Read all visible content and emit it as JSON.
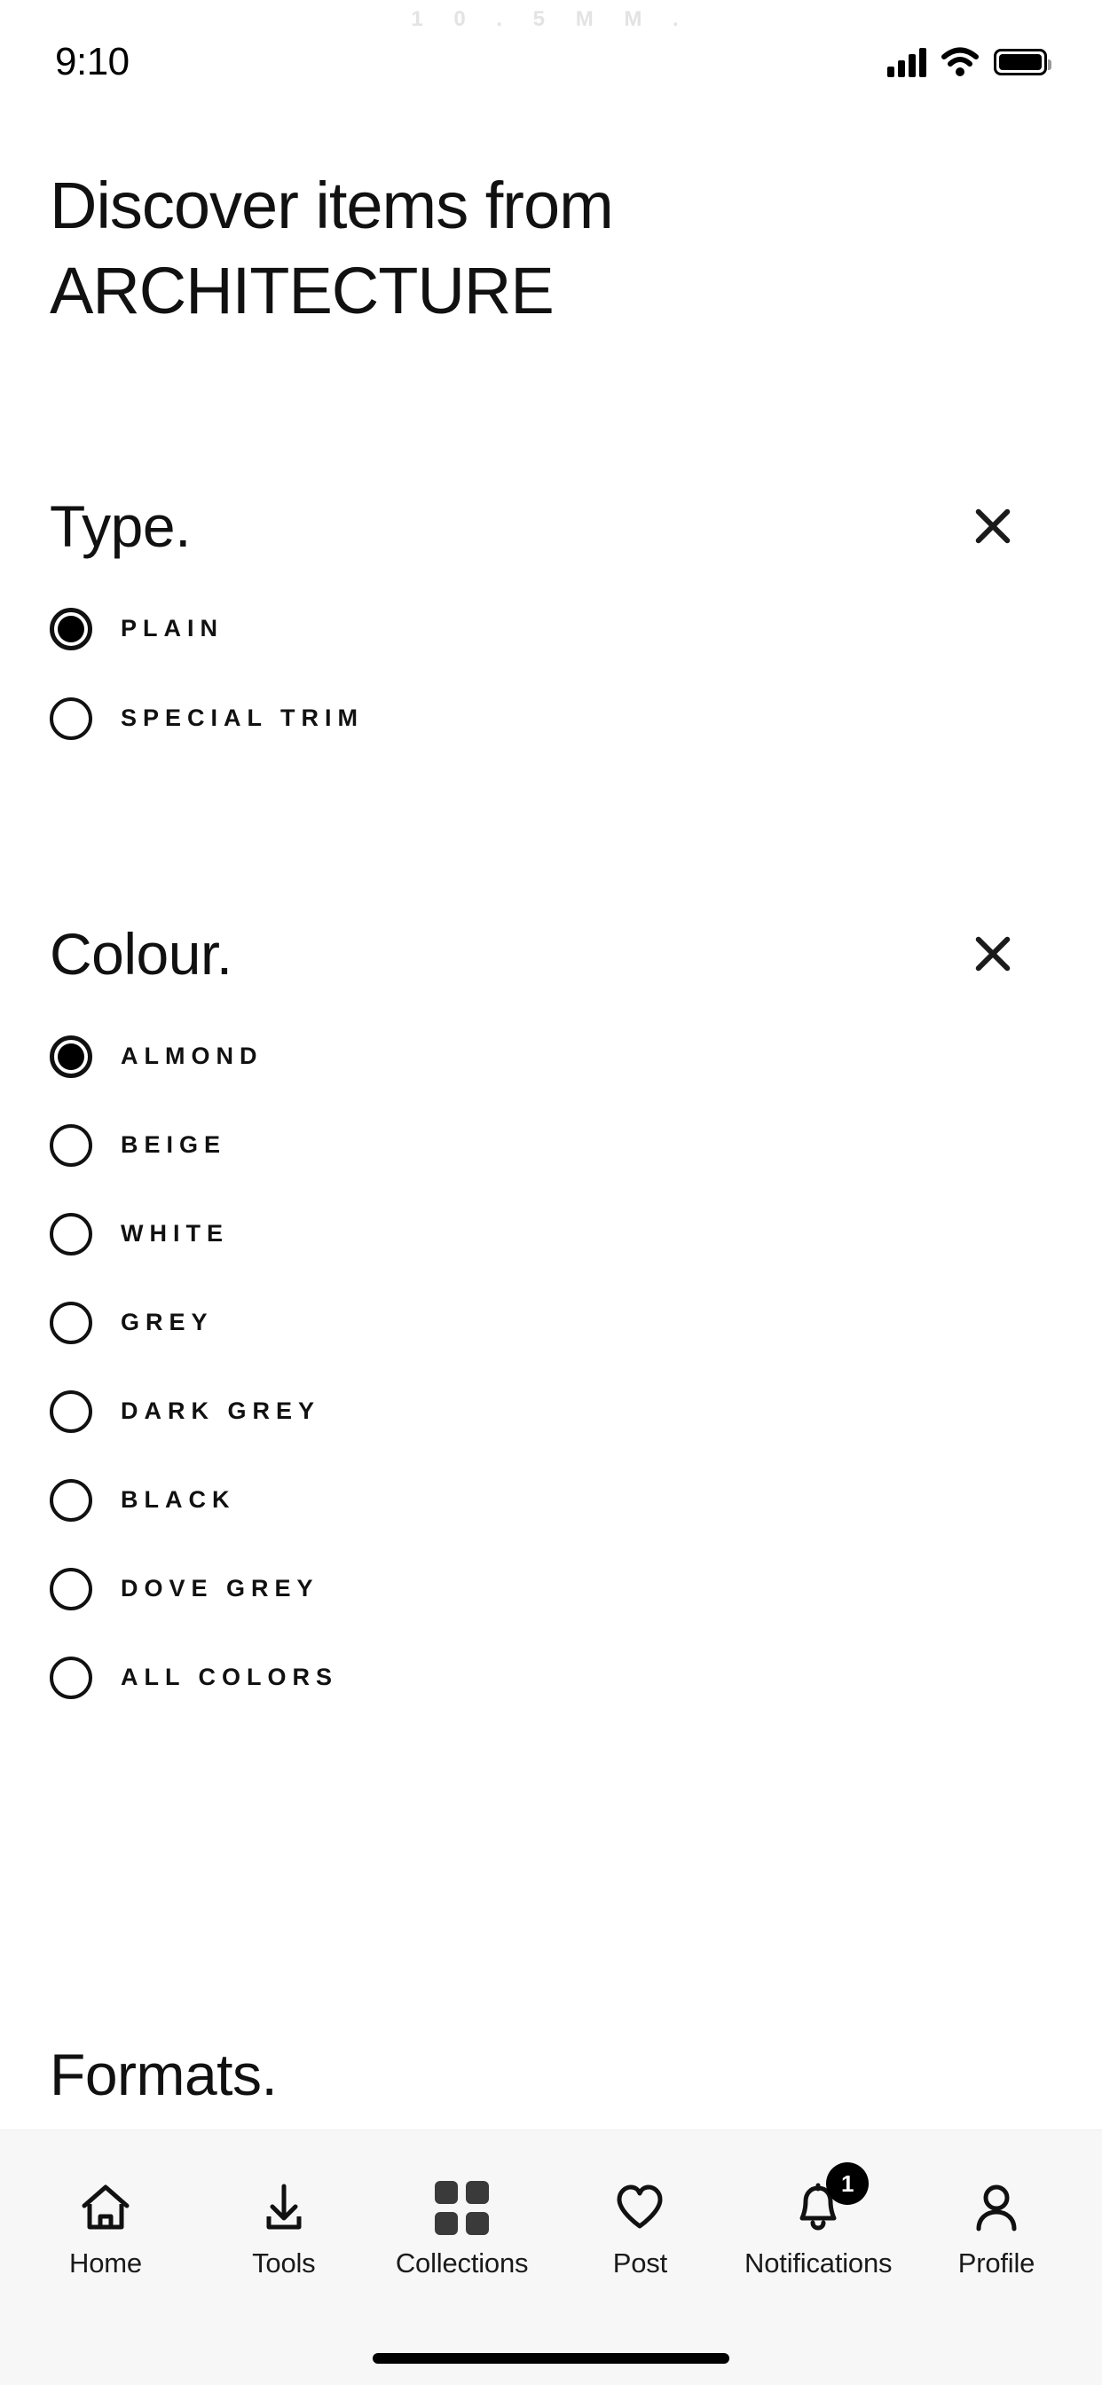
{
  "watermark": "1 0 . 5 M M .",
  "status_bar": {
    "time": "9:10",
    "signal_icon": "cellular-signal-icon",
    "wifi_icon": "wifi-icon",
    "battery_icon": "battery-full-icon"
  },
  "header": {
    "line1": "Discover items from",
    "line2": "ARCHITECTURE"
  },
  "sections": [
    {
      "title": "Type.",
      "close_label": "×",
      "options": [
        {
          "label": "PLAIN",
          "selected": true
        },
        {
          "label": "SPECIAL TRIM",
          "selected": false
        }
      ]
    },
    {
      "title": "Colour.",
      "close_label": "×",
      "options": [
        {
          "label": "ALMOND",
          "selected": true
        },
        {
          "label": "BEIGE",
          "selected": false
        },
        {
          "label": "WHITE",
          "selected": false
        },
        {
          "label": "GREY",
          "selected": false
        },
        {
          "label": "DARK GREY",
          "selected": false
        },
        {
          "label": "BLACK",
          "selected": false
        },
        {
          "label": "DOVE GREY",
          "selected": false
        },
        {
          "label": "ALL COLORS",
          "selected": false
        }
      ]
    },
    {
      "title": "Formats.",
      "options": []
    }
  ],
  "bottom_nav": {
    "items": [
      {
        "label": "Home",
        "icon": "home-icon",
        "active": false
      },
      {
        "label": "Tools",
        "icon": "download-icon",
        "active": false
      },
      {
        "label": "Collections",
        "icon": "grid-icon",
        "active": true
      },
      {
        "label": "Post",
        "icon": "heart-icon",
        "active": false
      },
      {
        "label": "Notifications",
        "icon": "bell-icon",
        "active": false,
        "badge": "1"
      },
      {
        "label": "Profile",
        "icon": "person-icon",
        "active": false
      }
    ]
  },
  "colors": {
    "background": "#ffffff",
    "text": "#111111",
    "nav_background": "#f7f7f8",
    "accent": "#000000",
    "watermark": "#e3e3e3"
  }
}
